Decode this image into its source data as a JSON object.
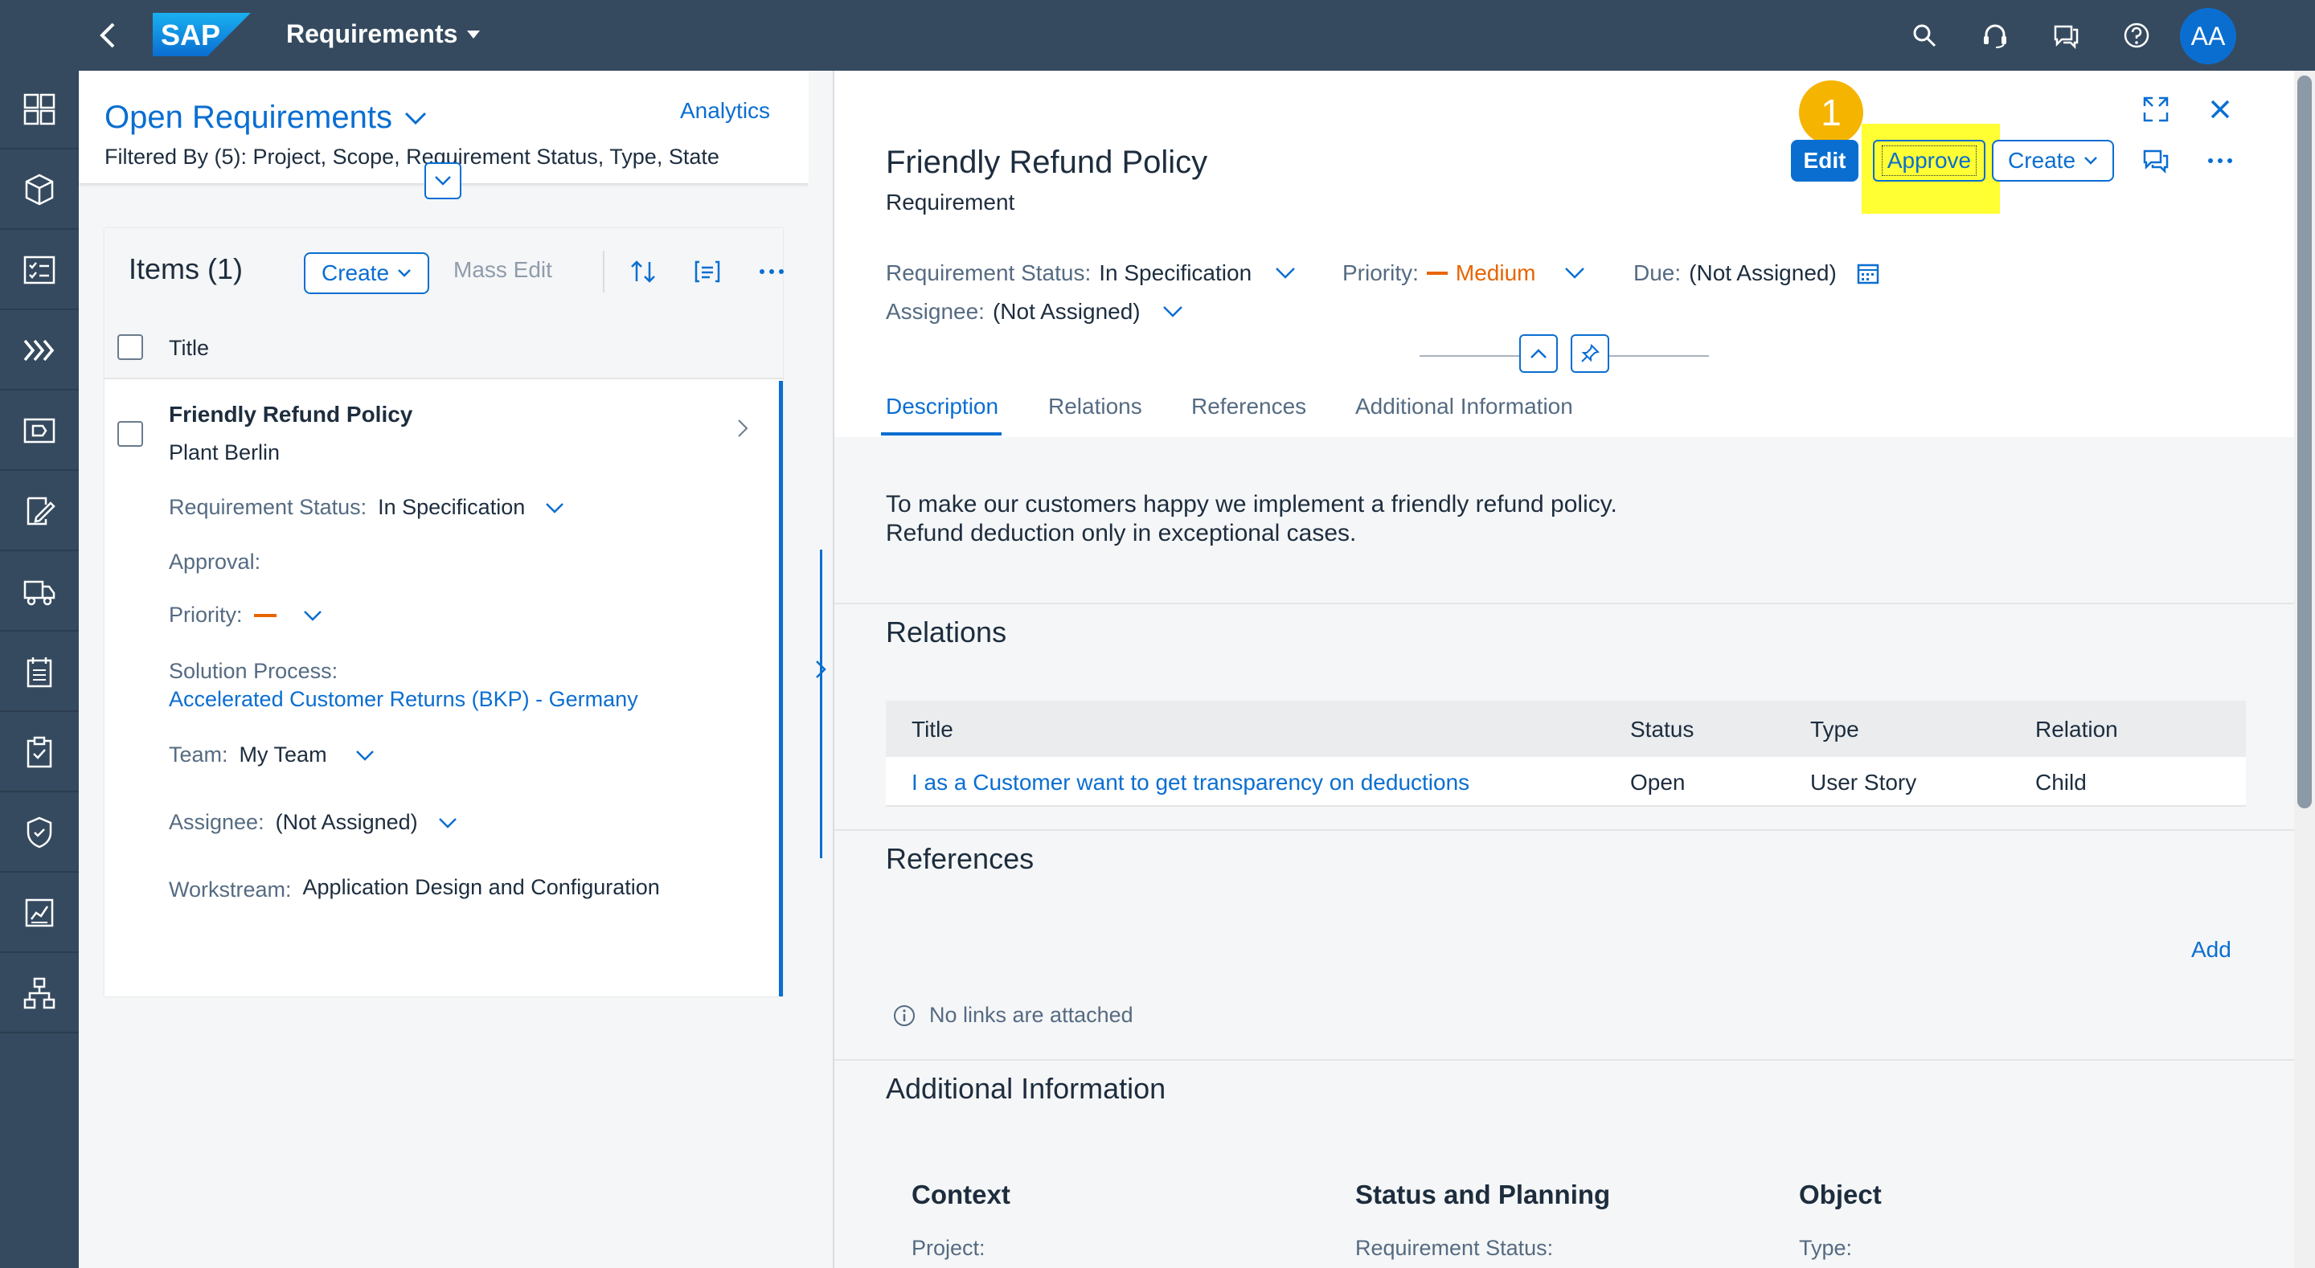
{
  "shell": {
    "app_title": "Requirements",
    "logo_text": "SAP",
    "avatar_initials": "AA",
    "icons": [
      "search-icon",
      "headset-icon",
      "feedback-icon",
      "help-icon"
    ]
  },
  "sidenav": {
    "items": [
      "dashboard-icon",
      "cube-icon",
      "checklist-icon",
      "process-icon",
      "screen-icon",
      "edit-document-icon",
      "shipping-icon",
      "calendar-list-icon",
      "clipboard-check-icon",
      "shield-check-icon",
      "report-icon",
      "hierarchy-icon"
    ]
  },
  "left": {
    "variant_title": "Open Requirements",
    "analytics": "Analytics",
    "filtered_by": "Filtered By (5): Project, Scope, Requirement Status, Type, State",
    "items_title": "Items (1)",
    "create_label": "Create",
    "mass_edit": "Mass Edit",
    "column_title": "Title",
    "item": {
      "title": "Friendly Refund Policy",
      "subtitle": "Plant Berlin",
      "status_label": "Requirement Status:",
      "status_value": "In Specification",
      "approval_label": "Approval:",
      "priority_label": "Priority:",
      "solution_label": "Solution Process:",
      "solution_value": "Accelerated Customer Returns (BKP) - Germany",
      "team_label": "Team:",
      "team_value": "My Team",
      "assignee_label": "Assignee:",
      "assignee_value": "(Not Assigned)",
      "workstream_label": "Workstream:",
      "workstream_value": "Application Design and Configuration"
    }
  },
  "object": {
    "title": "Friendly Refund Policy",
    "subtitle": "Requirement",
    "step_badge": "1",
    "edit": "Edit",
    "approve": "Approve",
    "create": "Create",
    "status_label": "Requirement Status:",
    "status_value": "In Specification",
    "priority_label": "Priority:",
    "priority_value": "Medium",
    "due_label": "Due:",
    "due_value": "(Not Assigned)",
    "assignee_label": "Assignee:",
    "assignee_value": "(Not Assigned)",
    "tabs": [
      "Description",
      "Relations",
      "References",
      "Additional Information"
    ],
    "description_line1": "To make our customers happy we implement a friendly refund policy.",
    "description_line2": "Refund deduction only in exceptional cases.",
    "relations_title": "Relations",
    "relations_columns": [
      "Title",
      "Status",
      "Type",
      "Relation"
    ],
    "relations_rows": [
      {
        "title": "I as a Customer want to get transparency on deductions",
        "status": "Open",
        "type": "User Story",
        "relation": "Child"
      }
    ],
    "references_title": "References",
    "add": "Add",
    "no_links": "No links are attached",
    "additional_title": "Additional Information",
    "additional_columns": [
      "Context",
      "Status and Planning",
      "Object"
    ],
    "additional_labels": [
      "Project:",
      "Requirement Status:",
      "Type:"
    ]
  },
  "colors": {
    "shell": "#354a5f",
    "accent": "#0a6ed1",
    "priority_medium": "#e76500",
    "highlight": "#ffff33",
    "badge": "#f5b400"
  }
}
